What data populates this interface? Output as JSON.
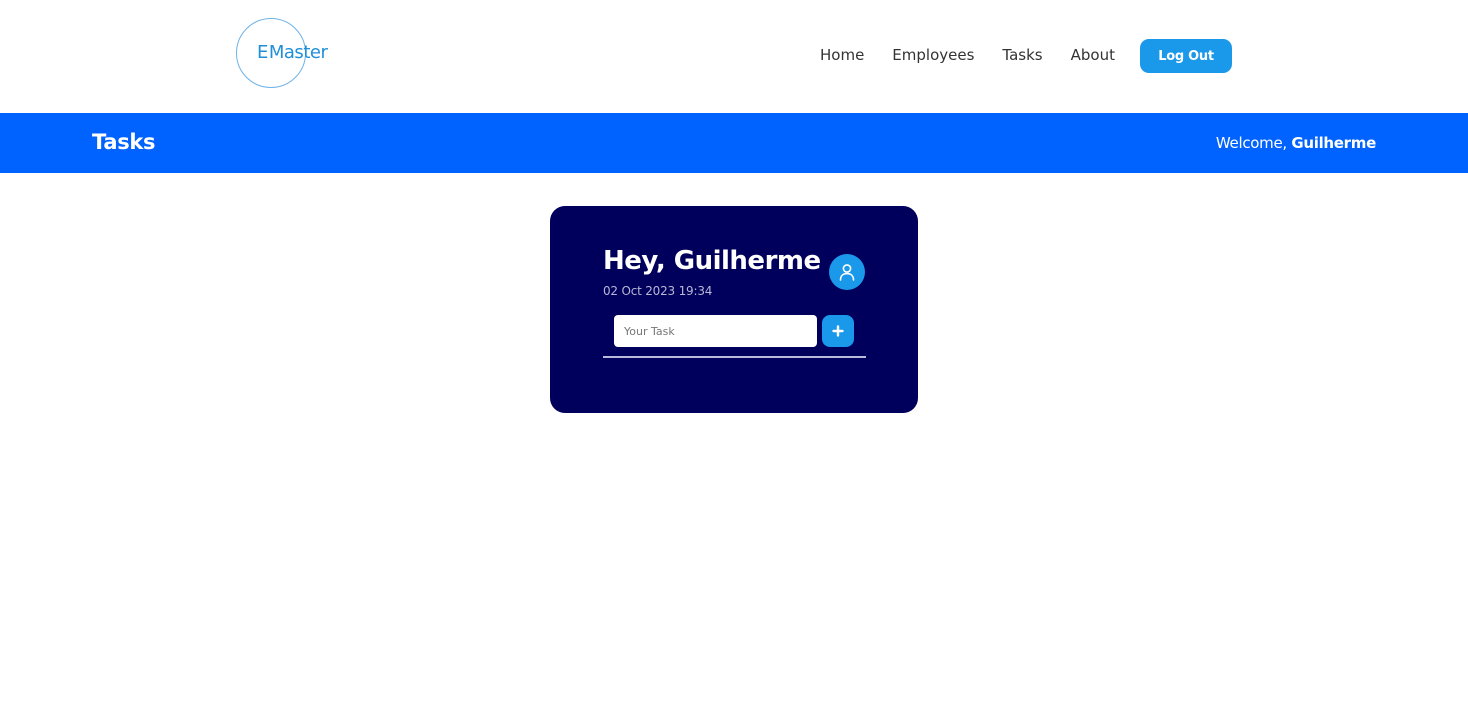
{
  "header": {
    "logo": {
      "letter": "E",
      "word": "Master"
    },
    "nav": [
      {
        "label": "Home"
      },
      {
        "label": "Employees"
      },
      {
        "label": "Tasks"
      },
      {
        "label": "About"
      }
    ],
    "logout_label": "Log Out"
  },
  "banner": {
    "title": "Tasks",
    "welcome_prefix": "Welcome,",
    "user_name": "Guilherme"
  },
  "card": {
    "greeting": "Hey, Guilherme",
    "datetime": "02 Oct 2023 19:34",
    "avatar_icon": "user-icon",
    "task_input": {
      "placeholder": "Your Task",
      "value": ""
    },
    "add_icon": "plus-icon"
  },
  "colors": {
    "brand_blue": "#0063ff",
    "accent_blue": "#1a98ea",
    "card_navy": "#00005c"
  }
}
